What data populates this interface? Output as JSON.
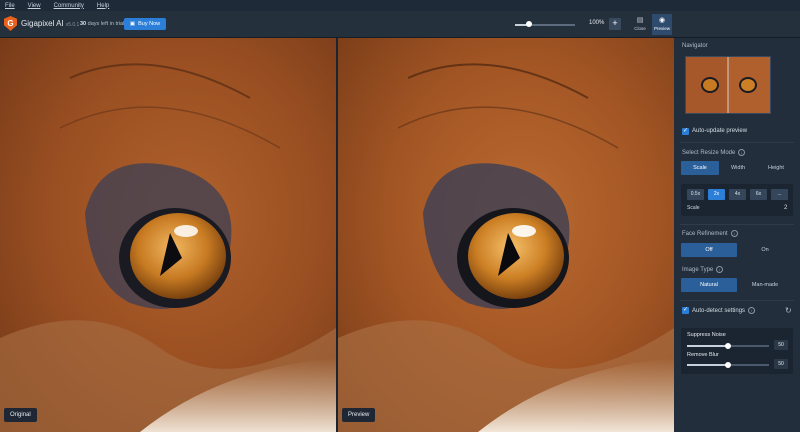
{
  "menu": [
    "File",
    "View",
    "Community",
    "Help"
  ],
  "app": {
    "name": "Gigapixel AI",
    "version": "v5.0.1",
    "trial_days": "30",
    "trial_suffix": "days left in trial",
    "buy_label": "Buy Now"
  },
  "toolbar": {
    "zoom": "100%",
    "zoom_plus": "+",
    "zoom_level": 0.2,
    "view_close": "Close",
    "view_preview": "Preview"
  },
  "images": {
    "left_label": "Original",
    "right_label": "Preview"
  },
  "sidebar": {
    "navigator_title": "Navigator",
    "auto_update": "Auto-update preview",
    "resize_mode_title": "Select Resize Mode",
    "resize_modes": [
      "Scale",
      "Width",
      "Height"
    ],
    "scale_options": [
      "0.5x",
      "2x",
      "4x",
      "6x",
      "..."
    ],
    "scale_label": "Scale",
    "scale_value": "2",
    "face_refinement_title": "Face Refinement",
    "face_options": [
      "Off",
      "On"
    ],
    "image_type_title": "Image Type",
    "image_types": [
      "Natural",
      "Man-made"
    ],
    "auto_detect": "Auto-detect settings",
    "suppress_noise_label": "Suppress Noise",
    "suppress_noise_value": "50",
    "suppress_noise_level": 0.5,
    "remove_blur_label": "Remove Blur",
    "remove_blur_value": "50",
    "remove_blur_level": 0.5
  },
  "colors": {
    "accent": "#2b7fd9",
    "logo": "#e8611d",
    "background": "#1b2532"
  }
}
